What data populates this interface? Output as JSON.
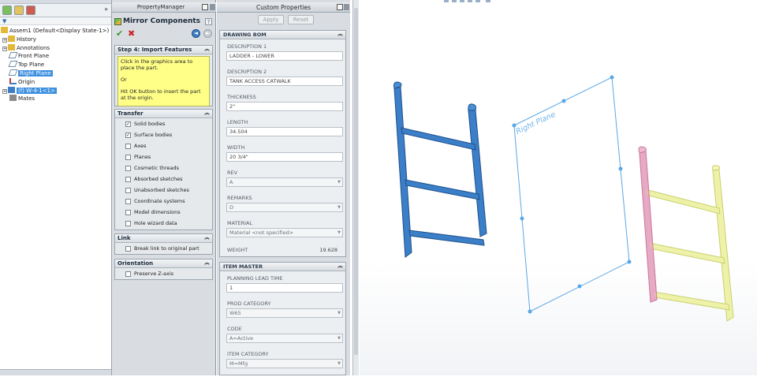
{
  "feature_tree": {
    "collapse_label": "»",
    "items": [
      {
        "label": "Assem1  (Default<Display State-1>)",
        "icon": "assembly-icon",
        "indent": 0,
        "expander": false
      },
      {
        "label": "History",
        "icon": "history-folder-icon",
        "indent": 1,
        "expander": true
      },
      {
        "label": "Annotations",
        "icon": "annotations-icon",
        "indent": 1,
        "expander": true
      },
      {
        "label": "Front Plane",
        "icon": "plane-icon",
        "indent": 1,
        "expander": false
      },
      {
        "label": "Top Plane",
        "icon": "plane-icon",
        "indent": 1,
        "expander": false
      },
      {
        "label": "Right Plane",
        "icon": "plane-icon",
        "indent": 1,
        "expander": false,
        "selected": true
      },
      {
        "label": "Origin",
        "icon": "origin-icon",
        "indent": 1,
        "expander": false
      },
      {
        "label": "(f) W-4-1<1>",
        "icon": "part-icon",
        "indent": 1,
        "expander": true,
        "selected": true
      },
      {
        "label": "Mates",
        "icon": "mates-icon",
        "indent": 1,
        "expander": false
      }
    ]
  },
  "property_manager": {
    "header": "PropertyManager",
    "title": "Mirror Components",
    "help_label": "?",
    "step_group": {
      "title": "Step 4: Import Features",
      "message_lines": [
        "Click in the graphics area to place the part.",
        "",
        "Or",
        "",
        "Hit OK button to insert the part at the origin."
      ]
    },
    "transfer_group": {
      "title": "Transfer",
      "options": [
        {
          "label": "Solid bodies",
          "checked": true
        },
        {
          "label": "Surface bodies",
          "checked": true
        },
        {
          "label": "Axes",
          "checked": false
        },
        {
          "label": "Planes",
          "checked": false
        },
        {
          "label": "Cosmetic threads",
          "checked": false
        },
        {
          "label": "Absorbed sketches",
          "checked": false
        },
        {
          "label": "Unabsorbed sketches",
          "checked": false
        },
        {
          "label": "Coordinate systems",
          "checked": false
        },
        {
          "label": "Model dimensions",
          "checked": false
        },
        {
          "label": "Hole wizard data",
          "checked": false
        }
      ]
    },
    "link_group": {
      "title": "Link",
      "option": {
        "label": "Break link to original part",
        "checked": false
      }
    },
    "orientation_group": {
      "title": "Orientation",
      "option": {
        "label": "Preserve Z-axis",
        "checked": false
      }
    }
  },
  "custom_properties": {
    "title": "Custom Properties",
    "apply_label": "Apply",
    "reset_label": "Reset",
    "drawing_bom": {
      "title": "DRAWING BOM",
      "fields": [
        {
          "label": "DESCRIPTION 1",
          "value": "LADDER - LOWER",
          "dropdown": false
        },
        {
          "label": "DESCRIPTION 2",
          "value": "TANK ACCESS CATWALK",
          "dropdown": false
        },
        {
          "label": "THICKNESS",
          "value": "2\"",
          "dropdown": false
        },
        {
          "label": "LENGTH",
          "value": "34.504",
          "dropdown": false
        },
        {
          "label": "WIDTH",
          "value": "20 3/4\"",
          "dropdown": false
        },
        {
          "label": "REV",
          "value": "A",
          "dropdown": true
        },
        {
          "label": "REMARKS",
          "value": "D",
          "dropdown": true
        },
        {
          "label": "MATERIAL",
          "value": "Material <not specified>",
          "dropdown": true
        }
      ],
      "weight_label": "WEIGHT",
      "weight_value": "19.628"
    },
    "item_master": {
      "title": "ITEM MASTER",
      "fields": [
        {
          "label": "PLANNING LEAD TIME",
          "value": "1",
          "dropdown": false
        },
        {
          "label": "PROD CATEGORY",
          "value": "W65",
          "dropdown": true
        },
        {
          "label": "CODE",
          "value": "A=Active",
          "dropdown": true
        },
        {
          "label": "ITEM CATEGORY",
          "value": "M=Mfg",
          "dropdown": true
        }
      ]
    }
  },
  "graphics": {
    "plane_label": "Right Plane",
    "colors": {
      "ladder_original": "#3b7fc8",
      "ladder_original_dark": "#1f4f8a",
      "mirror_rail": "#e7a9c4",
      "mirror_body": "#eef2a8",
      "plane_outline": "#5aa7e6"
    }
  }
}
